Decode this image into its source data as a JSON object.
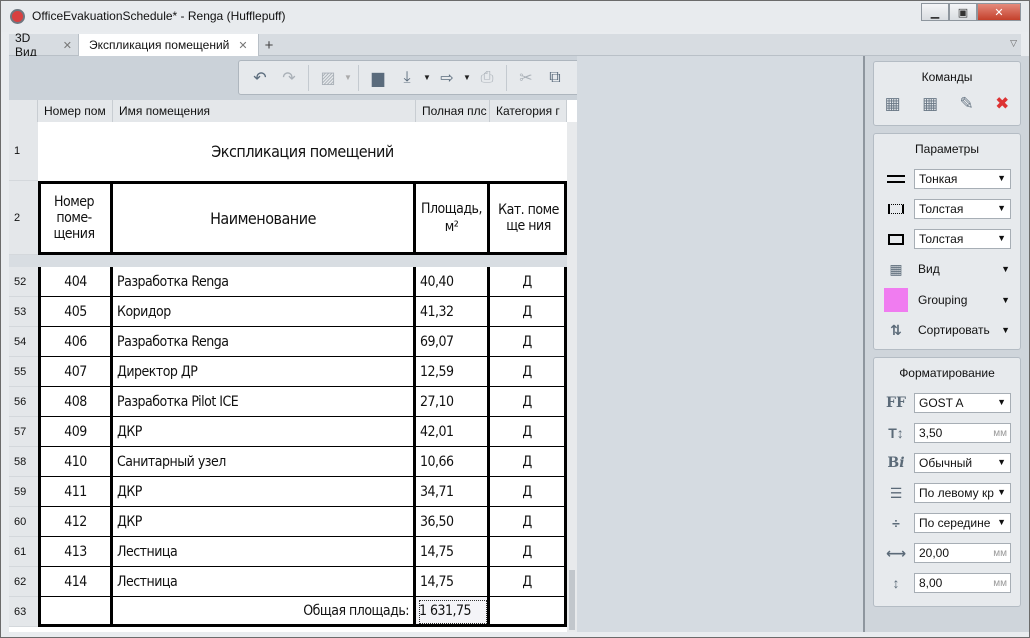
{
  "window": {
    "title": "OfficeEvakuationSchedule* - Renga (Hufflepuff)"
  },
  "tabs": [
    {
      "label": "3D Вид",
      "active": false
    },
    {
      "label": "Экспликация помещений",
      "active": true
    }
  ],
  "toolbar": {
    "icons": [
      "undo-icon",
      "redo-icon",
      "3d-view-icon",
      "open-folder-icon",
      "import-icon",
      "export-icon",
      "print-icon",
      "cut-icon",
      "copy-icon",
      "paste-icon",
      "link-icon",
      "table-view-icon",
      "settings-wrench-icon",
      "help-icon"
    ]
  },
  "grid": {
    "column_headers": [
      "Номер пом",
      "Имя помещения",
      "Полная плс",
      "Категория г"
    ],
    "title_row": {
      "num": "1",
      "text": "Экспликация помещений"
    },
    "header_row": {
      "num": "2",
      "cols": [
        "Номер поме-щения",
        "Наименование",
        "Площадь, м²",
        "Кат. поме ще ния"
      ]
    },
    "rows": [
      {
        "num": "52",
        "room": "404",
        "name": "Разработка Renga",
        "area": "40,40",
        "cat": "Д"
      },
      {
        "num": "53",
        "room": "405",
        "name": "Коридор",
        "area": "41,32",
        "cat": "Д"
      },
      {
        "num": "54",
        "room": "406",
        "name": "Разработка Renga",
        "area": "69,07",
        "cat": "Д"
      },
      {
        "num": "55",
        "room": "407",
        "name": "Директор ДР",
        "area": "12,59",
        "cat": "Д"
      },
      {
        "num": "56",
        "room": "408",
        "name": "Разработка Pilot ICE",
        "area": "27,10",
        "cat": "Д"
      },
      {
        "num": "57",
        "room": "409",
        "name": "ДКР",
        "area": "42,01",
        "cat": "Д"
      },
      {
        "num": "58",
        "room": "410",
        "name": "Санитарный узел",
        "area": "10,66",
        "cat": "Д"
      },
      {
        "num": "59",
        "room": "411",
        "name": "ДКР",
        "area": "34,71",
        "cat": "Д"
      },
      {
        "num": "60",
        "room": "412",
        "name": "ДКР",
        "area": "36,50",
        "cat": "Д"
      },
      {
        "num": "61",
        "room": "413",
        "name": "Лестница",
        "area": "14,75",
        "cat": "Д"
      },
      {
        "num": "62",
        "room": "414",
        "name": "Лестница",
        "area": "14,75",
        "cat": "Д"
      }
    ],
    "total_row": {
      "num": "63",
      "label": "Общая площадь:",
      "value": "1 631,75"
    }
  },
  "commands": {
    "title": "Команды",
    "icons": [
      "insert-rows-above-icon",
      "insert-rows-below-icon",
      "edit-row-icon",
      "delete-row-icon"
    ]
  },
  "parameters": {
    "title": "Параметры",
    "inner_lines": "Тонкая",
    "outer_lines": "Толстая",
    "border": "Толстая",
    "view": "Вид",
    "grouping": "Grouping",
    "grouping_color": "#f07cf0",
    "sort": "Сортировать"
  },
  "formatting": {
    "title": "Форматирование",
    "font": "GOST A",
    "font_size": "3,50",
    "unit": "мм",
    "style": "Обычный",
    "h_align": "По левому кр",
    "v_align": "По середине",
    "width": "20,00",
    "height": "8,00"
  }
}
